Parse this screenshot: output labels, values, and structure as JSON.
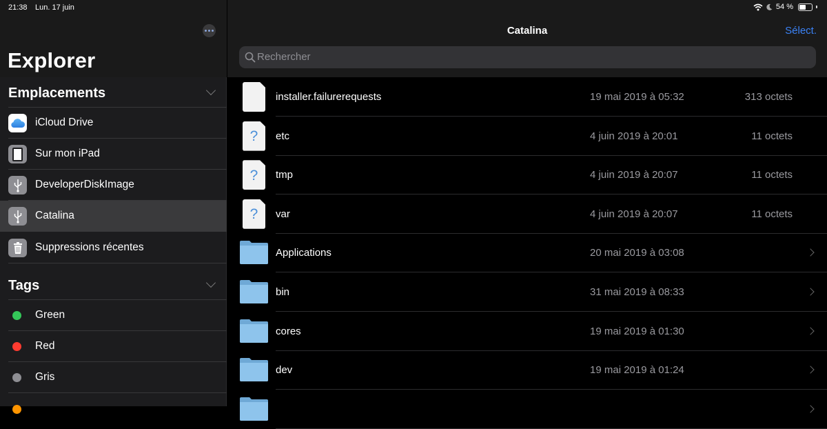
{
  "status_bar": {
    "time": "21:38",
    "date": "Lun. 17 juin",
    "battery": "54 %",
    "battery_level": 0.54
  },
  "sidebar": {
    "title": "Explorer",
    "locations_title": "Emplacements",
    "locations": [
      {
        "label": "iCloud Drive",
        "icon": "icloud-icon"
      },
      {
        "label": "Sur mon iPad",
        "icon": "ipad-icon"
      },
      {
        "label": "DeveloperDiskImage",
        "icon": "usb-icon"
      },
      {
        "label": "Catalina",
        "icon": "usb-icon",
        "selected": true
      },
      {
        "label": "Suppressions récentes",
        "icon": "trash-icon"
      }
    ],
    "tags_title": "Tags",
    "tags": [
      {
        "label": "Green",
        "color": "#34c759"
      },
      {
        "label": "Red",
        "color": "#ff3b30"
      },
      {
        "label": "Gris",
        "color": "#8e8e93"
      },
      {
        "label": "",
        "color": "#ff9500"
      }
    ]
  },
  "main": {
    "title": "Catalina",
    "select_label": "Sélect.",
    "search_placeholder": "Rechercher",
    "files": [
      {
        "name": "installer.failurerequests",
        "date": "19 mai 2019 à 05:32",
        "size": "313 octets",
        "kind": "file"
      },
      {
        "name": "etc",
        "date": "4 juin 2019 à 20:01",
        "size": "11 octets",
        "kind": "unknown"
      },
      {
        "name": "tmp",
        "date": "4 juin 2019 à 20:07",
        "size": "11 octets",
        "kind": "unknown"
      },
      {
        "name": "var",
        "date": "4 juin 2019 à 20:07",
        "size": "11 octets",
        "kind": "unknown"
      },
      {
        "name": "Applications",
        "date": "20 mai 2019 à 03:08",
        "size": "",
        "kind": "folder"
      },
      {
        "name": "bin",
        "date": "31 mai 2019 à 08:33",
        "size": "",
        "kind": "folder"
      },
      {
        "name": "cores",
        "date": "19 mai 2019 à 01:30",
        "size": "",
        "kind": "folder"
      },
      {
        "name": "dev",
        "date": "19 mai 2019 à 01:24",
        "size": "",
        "kind": "folder"
      },
      {
        "name": "",
        "date": "",
        "size": "",
        "kind": "folder"
      }
    ]
  },
  "colors": {
    "accent": "#3b82f6",
    "folder": "#8ec4ec"
  }
}
